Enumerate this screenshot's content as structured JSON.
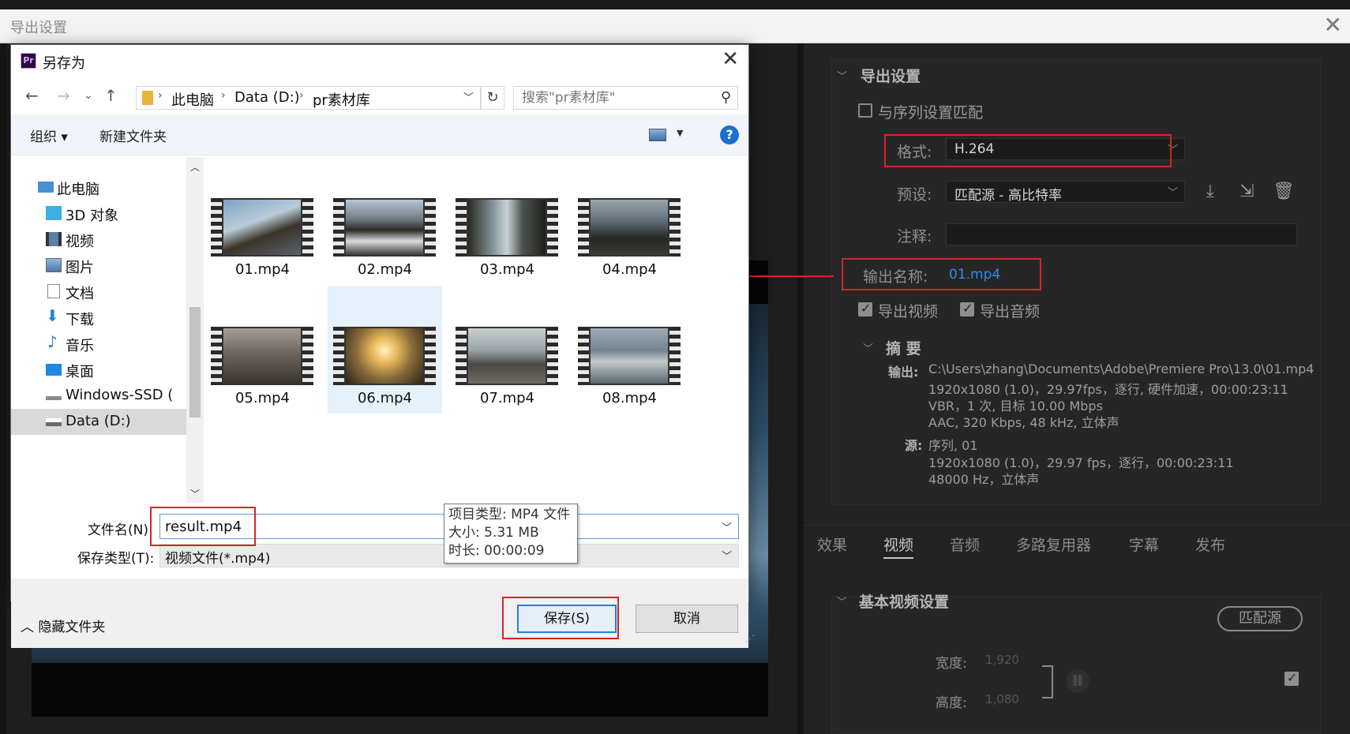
{
  "export_window": {
    "title": "导出设置",
    "close_glyph": "✕"
  },
  "export_settings": {
    "section_title": "导出设置",
    "match_sequence_label": "与序列设置匹配",
    "format_label": "格式:",
    "format_value": "H.264",
    "preset_label": "预设:",
    "preset_value": "匹配源 - 高比特率",
    "comment_label": "注释:",
    "output_name_label": "输出名称:",
    "output_name_value": "01.mp4",
    "export_video_label": "导出视频",
    "export_audio_label": "导出音频",
    "summary_title": "摘 要",
    "output_label": "输出:",
    "output_lines": [
      "C:\\Users\\zhang\\Documents\\Adobe\\Premiere Pro\\13.0\\01.mp4",
      "1920x1080 (1.0)，29.97fps，逐行, 硬件加速，00:00:23:11",
      "VBR，1 次, 目标 10.00 Mbps",
      "AAC, 320 Kbps, 48  kHz, 立体声"
    ],
    "source_label": "源:",
    "source_lines": [
      "序列, 01",
      "1920x1080 (1.0)，29.97 fps，逐行，00:00:23:11",
      "48000 Hz，立体声"
    ]
  },
  "tabs": [
    {
      "label": "效果",
      "active": false
    },
    {
      "label": "视频",
      "active": true
    },
    {
      "label": "音频",
      "active": false
    },
    {
      "label": "多路复用器",
      "active": false
    },
    {
      "label": "字幕",
      "active": false
    },
    {
      "label": "发布",
      "active": false
    }
  ],
  "basic_video": {
    "title": "基本视频设置",
    "match_source_label": "匹配源",
    "width_label": "宽度:",
    "width_value": "1,920",
    "height_label": "高度:",
    "height_value": "1,080"
  },
  "save_dialog": {
    "app_icon_text": "Pr",
    "title": "另存为",
    "close_glyph": "✕",
    "nav": {
      "back": "←",
      "forward": "→",
      "recent": "⌄",
      "up": "↑"
    },
    "address": [
      "此电脑",
      "Data (D:)",
      "pr素材库"
    ],
    "search_placeholder": "搜索\"pr素材库\"",
    "toolbar": {
      "organize": "组织 ▾",
      "new_folder": "新建文件夹",
      "help": "?"
    },
    "tree": [
      {
        "label": "此电脑",
        "icon": "computer-icon"
      },
      {
        "label": "3D 对象",
        "icon": "3d-objects-icon"
      },
      {
        "label": "视频",
        "icon": "videos-icon"
      },
      {
        "label": "图片",
        "icon": "pictures-icon"
      },
      {
        "label": "文档",
        "icon": "documents-icon"
      },
      {
        "label": "下载",
        "icon": "download-icon"
      },
      {
        "label": "音乐",
        "icon": "music-icon"
      },
      {
        "label": "桌面",
        "icon": "desktop-icon"
      },
      {
        "label": "Windows-SSD (",
        "icon": "drive-icon"
      },
      {
        "label": "Data (D:)",
        "icon": "drive-icon"
      }
    ],
    "files": [
      "01.mp4",
      "02.mp4",
      "03.mp4",
      "04.mp4",
      "05.mp4",
      "06.mp4",
      "07.mp4",
      "08.mp4"
    ],
    "tooltip": {
      "type": "项目类型: MP4 文件",
      "size": "大小: 5.31 MB",
      "duration": "时长: 00:00:09"
    },
    "filename_label": "文件名(N):",
    "filename_value": "result.mp4",
    "filetype_label": "保存类型(T):",
    "filetype_value": "视频文件(*.mp4)",
    "hide_folders_label": "隐藏文件夹",
    "save_label": "保存(S)",
    "cancel_label": "取消"
  },
  "colors": {
    "annotation_red": "#d8232a",
    "output_name_blue": "#2d8ceb",
    "dark_bg": "#232323",
    "selection_blue": "#e5f1fb"
  }
}
